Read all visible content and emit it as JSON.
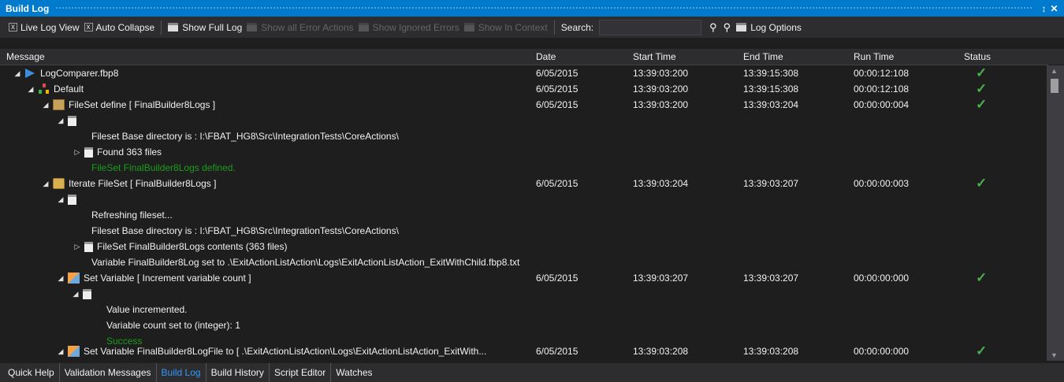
{
  "window": {
    "title": "Build Log",
    "pin_glyph": "↕",
    "close_glyph": "✕"
  },
  "toolbar": {
    "live_log_view": {
      "label": "Live Log View",
      "checked": "x"
    },
    "auto_collapse": {
      "label": "Auto Collapse",
      "checked": "x"
    },
    "show_full_log": "Show Full Log",
    "show_all_error_actions": "Show all Error Actions",
    "show_ignored_errors": "Show Ignored Errors",
    "show_in_context": "Show In Context",
    "search_label": "Search:",
    "search_value": "",
    "log_options": "Log Options"
  },
  "columns": {
    "message": "Message",
    "date": "Date",
    "start_time": "Start Time",
    "end_time": "End Time",
    "run_time": "Run Time",
    "status": "Status"
  },
  "rows": [
    {
      "text": "LogComparer.fbp8",
      "date": "6/05/2015",
      "start": "13:39:03:200",
      "end": "13:39:15:308",
      "run": "00:00:12:108",
      "status": "✓"
    },
    {
      "text": "Default",
      "date": "6/05/2015",
      "start": "13:39:03:200",
      "end": "13:39:15:308",
      "run": "00:00:12:108",
      "status": "✓"
    },
    {
      "text": "FileSet define [ FinalBuilder8Logs ]",
      "date": "6/05/2015",
      "start": "13:39:03:200",
      "end": "13:39:03:204",
      "run": "00:00:00:004",
      "status": "✓"
    },
    {
      "text": ""
    },
    {
      "text": "Fileset Base directory is : I:\\FBAT_HG8\\Src\\IntegrationTests\\CoreActions\\"
    },
    {
      "text": "Found 363 files"
    },
    {
      "text": "FileSet FinalBuilder8Logs defined."
    },
    {
      "text": "Iterate FileSet [ FinalBuilder8Logs ]",
      "date": "6/05/2015",
      "start": "13:39:03:204",
      "end": "13:39:03:207",
      "run": "00:00:00:003",
      "status": "✓"
    },
    {
      "text": ""
    },
    {
      "text": "Refreshing fileset..."
    },
    {
      "text": "Fileset Base directory is : I:\\FBAT_HG8\\Src\\IntegrationTests\\CoreActions\\"
    },
    {
      "text": "FileSet FinalBuilder8Logs contents (363 files)"
    },
    {
      "text": "Variable FinalBuilder8Log set to .\\ExitActionListAction\\Logs\\ExitActionListAction_ExitWithChild.fbp8.txt"
    },
    {
      "text": "Set Variable [ Increment variable count ]",
      "date": "6/05/2015",
      "start": "13:39:03:207",
      "end": "13:39:03:207",
      "run": "00:00:00:000",
      "status": "✓"
    },
    {
      "text": ""
    },
    {
      "text": "Value incremented."
    },
    {
      "text": "Variable count set to (integer): 1"
    },
    {
      "text": "Success"
    },
    {
      "text": "Set Variable FinalBuilder8LogFile to [ .\\ExitActionListAction\\Logs\\ExitActionListAction_ExitWith...",
      "date": "6/05/2015",
      "start": "13:39:03:208",
      "end": "13:39:03:208",
      "run": "00:00:00:000",
      "status": "✓"
    }
  ],
  "tabs": [
    "Quick Help",
    "Validation Messages",
    "Build Log",
    "Build History",
    "Script Editor",
    "Watches"
  ],
  "active_tab": "Build Log",
  "colors": {
    "accent": "#007acc",
    "success_text": "#1a9e1a",
    "status_check": "#4caf50",
    "active_tab": "#3399ff"
  }
}
